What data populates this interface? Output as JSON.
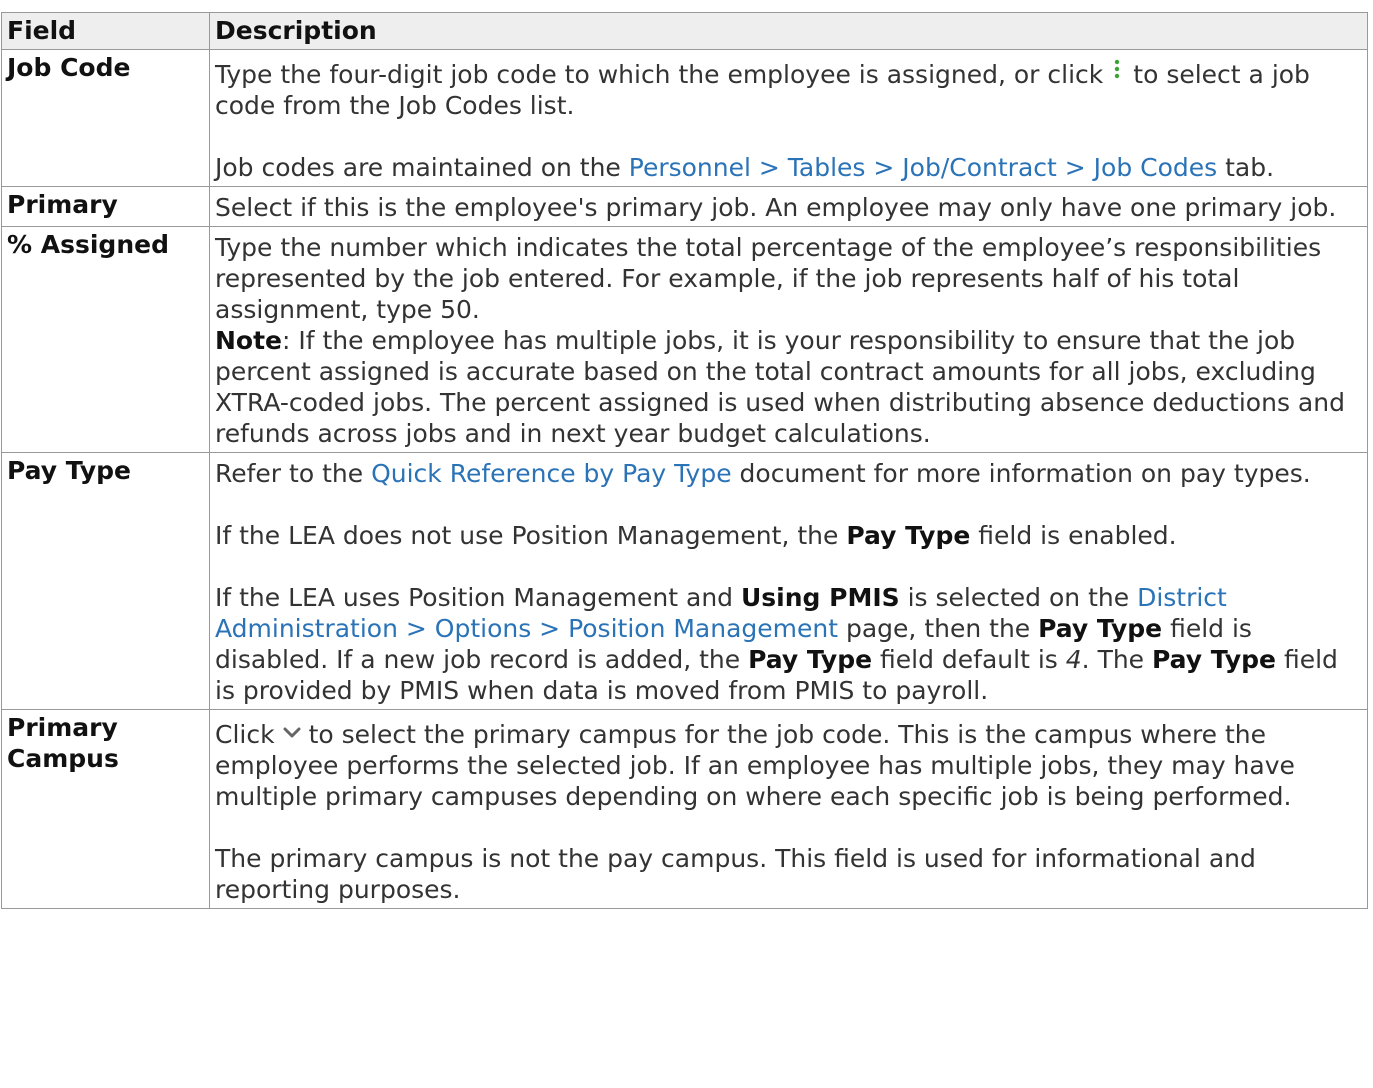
{
  "table": {
    "header": {
      "field": "Field",
      "description": "Description"
    },
    "rows": [
      {
        "field": "Job Code",
        "p1_a": "Type the four-digit job code to which the employee is assigned, or click",
        "p1_icon": "kebab-menu-icon",
        "p1_b": "to select a job code from the Job Codes list.",
        "p2_a": "Job codes are maintained on the ",
        "p2_link": "Personnel > Tables > Job/Contract > Job Codes",
        "p2_b": " tab."
      },
      {
        "field": "Primary",
        "text": "Select if this is the employee's primary job. An employee may only have one primary job."
      },
      {
        "field": "% Assigned",
        "text": "Type the number which indicates the total percentage of the employee’s responsibilities represented by the job entered. For example, if the job represents half of his total assignment, type 50.",
        "note_label": "Note",
        "note_text": ": If the employee has multiple jobs, it is your responsibility to ensure that the job percent assigned is accurate based on the total contract amounts for all jobs, excluding XTRA-coded jobs. The percent assigned is used when distributing absence deductions and refunds across jobs and in next year budget calculations."
      },
      {
        "field": "Pay Type",
        "p1_a": "Refer to the ",
        "p1_link": "Quick Reference by Pay Type",
        "p1_b": " document for more information on pay types.",
        "p2_a": "If the LEA does not use Position Management, the ",
        "p2_bold": "Pay Type",
        "p2_b": " field is enabled.",
        "p3_a": "If the LEA uses Position Management and ",
        "p3_bold1": "Using PMIS",
        "p3_b": " is selected on the ",
        "p3_link": "District Administration > Options > Position Management",
        "p3_c": " page, then the ",
        "p3_bold2": "Pay Type",
        "p3_d": " field is disabled. If a new job record is added, the ",
        "p3_bold3": "Pay Type",
        "p3_e": " field default is ",
        "p3_italic": "4",
        "p3_f": ". The ",
        "p3_bold4": "Pay Type",
        "p3_g": " field is provided by PMIS when data is moved from PMIS to payroll."
      },
      {
        "field": "Primary Campus",
        "p1_a": "Click",
        "p1_icon": "chevron-down-icon",
        "p1_b": "to select the primary campus for the job code. This is the campus where the employee performs the selected job. If an employee has multiple jobs, they may have multiple primary campuses depending on where each specific job is being performed.",
        "p2": "The primary campus is not the pay campus. This field is used for informational and reporting purposes."
      }
    ]
  },
  "colors": {
    "link": "#2b73b7",
    "border": "#999999",
    "header_bg": "#eeeeee",
    "icon_green": "#3aa335",
    "icon_gray": "#666666"
  }
}
